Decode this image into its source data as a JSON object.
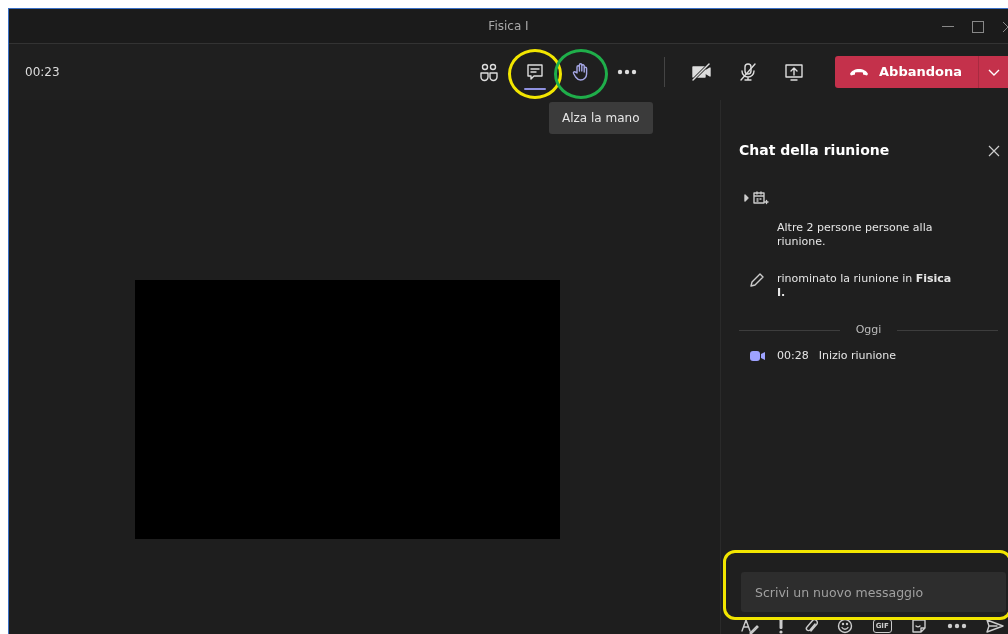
{
  "window": {
    "title": "Fisica I"
  },
  "toolbar": {
    "timer": "00:23",
    "buttons": [
      {
        "kind": "people",
        "selected": false,
        "hovered": false
      },
      {
        "kind": "chat",
        "selected": true,
        "hovered": false,
        "annotation": {
          "color": "#f2e600"
        }
      },
      {
        "kind": "hand",
        "selected": false,
        "hovered": true,
        "annotation": {
          "color": "#1fae4a"
        }
      },
      {
        "kind": "more",
        "selected": false,
        "hovered": false
      }
    ],
    "media_buttons": [
      {
        "kind": "camera-off"
      },
      {
        "kind": "mic-off"
      },
      {
        "kind": "share"
      }
    ],
    "leave_button": {
      "label": "Abbandona"
    }
  },
  "tooltip": {
    "text": "Alza la mano"
  },
  "chat": {
    "title": "Chat della riunione",
    "messages": [
      {
        "kind": "calendar"
      },
      {
        "kind": "system",
        "text": "Altre 2 persone persone alla riunione."
      },
      {
        "kind": "rename",
        "text": "rinominato la riunione in **Fisica I.**"
      },
      {
        "kind": "divider",
        "text": "Oggi"
      },
      {
        "kind": "meeting",
        "time": "00:28",
        "text": "Inizio riunione"
      }
    ],
    "composer": {
      "placeholder": "Scrivi un nuovo messaggio",
      "annotation": {
        "color": "#f2e600"
      }
    },
    "compose_tools": [
      {
        "kind": "format"
      },
      {
        "kind": "important"
      },
      {
        "kind": "attach"
      },
      {
        "kind": "emoji"
      },
      {
        "kind": "gif",
        "label": "GIF"
      },
      {
        "kind": "sticker"
      },
      {
        "kind": "more"
      },
      {
        "kind": "send"
      }
    ]
  }
}
